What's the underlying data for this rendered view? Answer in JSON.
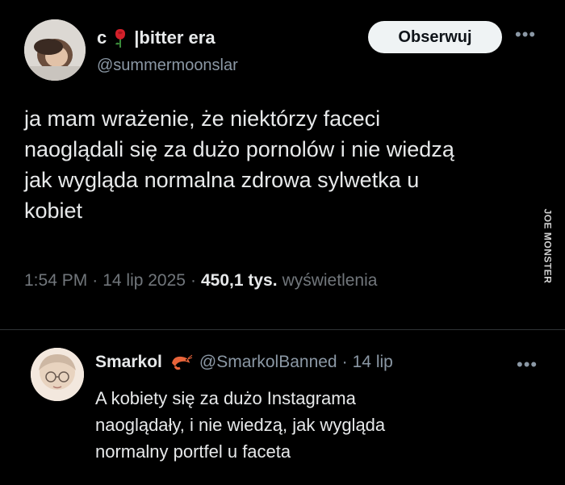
{
  "tweet": {
    "display_name_prefix": "c",
    "display_name_suffix": "|bitter era",
    "handle": "@summermoonslar",
    "follow_label": "Obserwuj",
    "text": "ja mam wrażenie, że niektórzy faceci\nnaoglądali się za dużo pornolów i nie wiedzą\njak wygląda normalna zdrowa  sylwetka u\nkobiet",
    "time": "1:54 PM",
    "date": "14 lip 2025",
    "views_count": "450,1 tys.",
    "views_label": "wyświetlenia",
    "more_icon": "more-horizontal-icon"
  },
  "watermark": "JOE MONSTER",
  "reply": {
    "display_name": "Smarkol",
    "handle": "@SmarkolBanned",
    "date": "14 lip",
    "text": "A kobiety się za dużo Instagrama\nnaoglądały, i nie wiedzą, jak wygląda\nnormalny portfel u faceta",
    "more_icon": "more-horizontal-icon"
  },
  "colors": {
    "background": "#000000",
    "text_primary": "#e7e9ea",
    "text_secondary": "#71767b",
    "divider": "#2f3336",
    "follow_button_bg": "#eff3f4"
  }
}
